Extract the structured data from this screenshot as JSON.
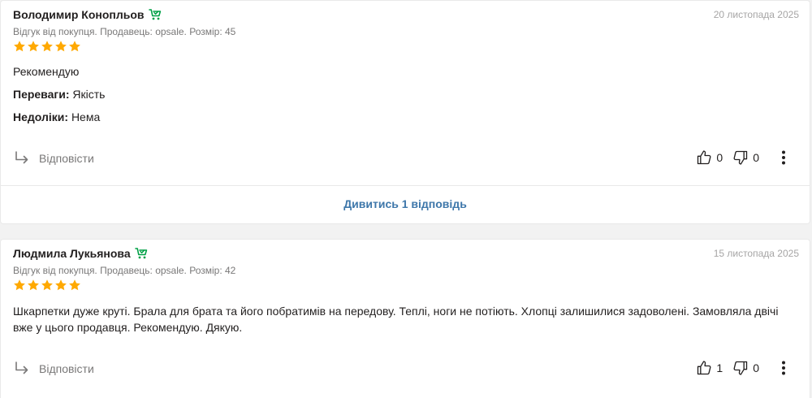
{
  "colors": {
    "star": "#ffa900",
    "seller_badge": "#00a046",
    "link": "#3e77aa",
    "muted": "#797878"
  },
  "reviews": [
    {
      "author": "Володимир Конопльов",
      "badge_icon": "cart-check-icon",
      "date": "20 листопада 2025",
      "meta": "Відгук від покупця. Продавець: opsale. Розмір: 45",
      "rating": 5,
      "text": "Рекомендую",
      "pros_label": "Переваги:",
      "pros": "Якість",
      "cons_label": "Недоліки:",
      "cons": "Нема",
      "reply_label": "Відповісти",
      "likes": "0",
      "dislikes": "0",
      "see_replies": "Дивитись 1 відповідь"
    },
    {
      "author": "Людмила Лукьянова",
      "badge_icon": "cart-check-icon",
      "date": "15 листопада 2025",
      "meta": "Відгук від покупця. Продавець: opsale. Розмір: 42",
      "rating": 5,
      "text_line1": "Шкарпетки дуже круті. Брала для брата та його побратимів на передову. Теплі, ноги не потіють. Хлопці залишилися задоволені. Замовляла двічі",
      "text_line2": "вже у цього продавця. Рекомендую. Дякую.",
      "reply_label": "Відповісти",
      "likes": "1",
      "dislikes": "0"
    }
  ]
}
